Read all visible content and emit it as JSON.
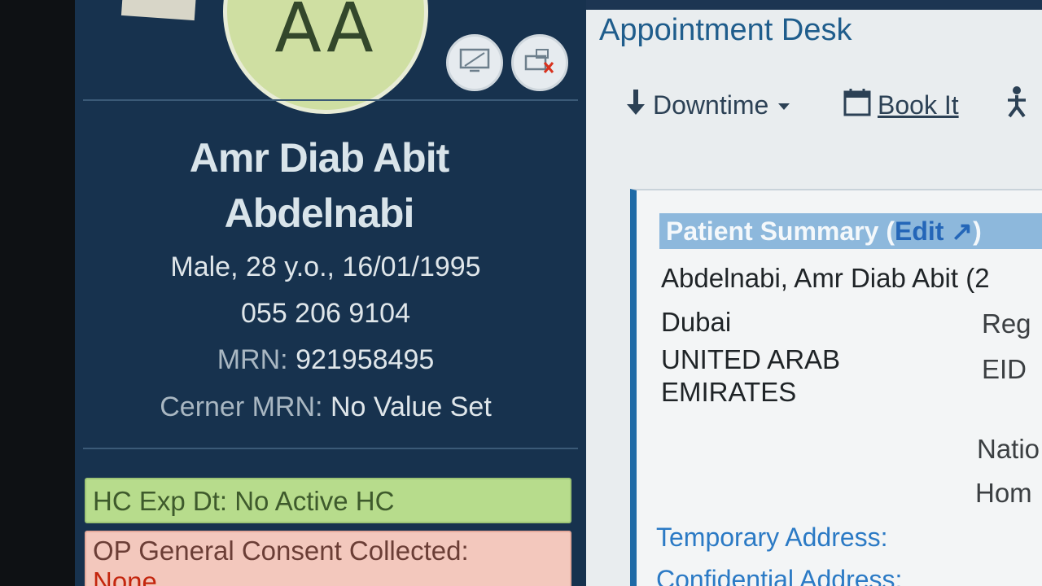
{
  "patient_banner": {
    "avatar_initials": "AA",
    "name_line1": "Amr Diab Abit",
    "name_line2": "Abdelnabi",
    "demographics": "Male, 28 y.o., 16/01/1995",
    "phone": "055 206 9104",
    "mrn_label": "MRN:",
    "mrn_value": "921958495",
    "cerner_mrn_label": "Cerner MRN:",
    "cerner_mrn_value": "No Value Set",
    "hc_alert": "HC Exp Dt: No Active HC",
    "consent_label": "OP General Consent Collected:",
    "consent_value": "None",
    "icons": [
      "monitor-icon",
      "disconnected-device-icon"
    ]
  },
  "appointment_desk": {
    "title": "Appointment Desk",
    "toolbar": {
      "downtime_label": "Downtime",
      "book_it_label": "Book It"
    },
    "patient_summary": {
      "header_label": "Patient Summary (",
      "edit_label": "Edit",
      "header_close": ")",
      "name_line": "Abdelnabi, Amr Diab Abit (2",
      "city": "Dubai",
      "country_line1": "UNITED ARAB",
      "country_line2": "EMIRATES",
      "reg_label": "Reg",
      "eid_label": "EID",
      "nationality_label": "Natio",
      "home_label": "Hom",
      "temporary_address_link": "Temporary Address:",
      "confidential_address_link": "Confidential Address:"
    }
  },
  "colors": {
    "banner_background": "#17324e",
    "avatar_fill": "#cfdfa2",
    "hc_alert_green": "#b7dc8c",
    "consent_alert_pink": "#f3c8bd",
    "summary_header_blue": "#8db8dc",
    "link_blue": "#2b7ac5"
  }
}
